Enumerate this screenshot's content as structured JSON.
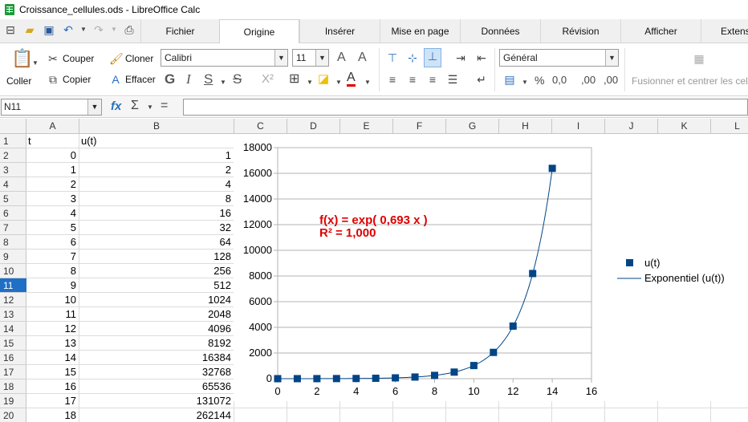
{
  "window": {
    "title": "Croissance_cellules.ods - LibreOffice Calc"
  },
  "tabs": [
    "Fichier",
    "Origine",
    "Insérer",
    "Mise en page",
    "Données",
    "Révision",
    "Afficher",
    "Extensi"
  ],
  "active_tab": "Origine",
  "ribbon": {
    "paste_label": "Coller",
    "cut_label": "Couper",
    "copy_label": "Copier",
    "clone_label": "Cloner",
    "clear_label": "Effacer",
    "font_name": "Calibri",
    "font_size": "11",
    "number_format": "Général",
    "merge_label": "Fusionner et centrer les cellules",
    "percent_symbol": "%",
    "decimal_symbol": "0,0",
    "add_decimal_symbol": ",00",
    "remove_decimal_symbol": ",00"
  },
  "formula_bar": {
    "name_box": "N11",
    "formula": ""
  },
  "columns": [
    "A",
    "B",
    "C",
    "D",
    "E",
    "F",
    "G",
    "H",
    "I",
    "J",
    "K",
    "L"
  ],
  "rows": [
    "1",
    "2",
    "3",
    "4",
    "5",
    "6",
    "7",
    "8",
    "9",
    "10",
    "11",
    "12",
    "13",
    "14",
    "15",
    "16",
    "17",
    "18",
    "19",
    "20"
  ],
  "selected_row": "11",
  "header_row": {
    "a": "t",
    "b": "u(t)"
  },
  "data_rows": [
    {
      "t": "0",
      "u": "1"
    },
    {
      "t": "1",
      "u": "2"
    },
    {
      "t": "2",
      "u": "4"
    },
    {
      "t": "3",
      "u": "8"
    },
    {
      "t": "4",
      "u": "16"
    },
    {
      "t": "5",
      "u": "32"
    },
    {
      "t": "6",
      "u": "64"
    },
    {
      "t": "7",
      "u": "128"
    },
    {
      "t": "8",
      "u": "256"
    },
    {
      "t": "9",
      "u": "512"
    },
    {
      "t": "10",
      "u": "1024"
    },
    {
      "t": "11",
      "u": "2048"
    },
    {
      "t": "12",
      "u": "4096"
    },
    {
      "t": "13",
      "u": "8192"
    },
    {
      "t": "14",
      "u": "16384"
    },
    {
      "t": "15",
      "u": "32768"
    },
    {
      "t": "16",
      "u": "65536"
    },
    {
      "t": "17",
      "u": "131072"
    },
    {
      "t": "18",
      "u": "262144"
    }
  ],
  "chart_data": {
    "type": "scatter",
    "title": "",
    "xlabel": "",
    "ylabel": "",
    "xlim": [
      0,
      16
    ],
    "ylim": [
      0,
      18000
    ],
    "xticks": [
      "0",
      "2",
      "4",
      "6",
      "8",
      "10",
      "12",
      "14",
      "16"
    ],
    "yticks": [
      "0",
      "2000",
      "4000",
      "6000",
      "8000",
      "10000",
      "12000",
      "14000",
      "16000",
      "18000"
    ],
    "grid": "horizontal",
    "legend": "right",
    "series": [
      {
        "name": "u(t)",
        "x": [
          0,
          1,
          2,
          3,
          4,
          5,
          6,
          7,
          8,
          9,
          10,
          11,
          12,
          13,
          14
        ],
        "y": [
          1,
          2,
          4,
          8,
          16,
          32,
          64,
          128,
          256,
          512,
          1024,
          2048,
          4096,
          8192,
          16384
        ],
        "color": "#004586"
      }
    ],
    "trendline": {
      "name": "Exponentiel (u(t))",
      "type": "exponential",
      "coefficient": 0.693,
      "color": "#004586"
    },
    "annotation": {
      "equation": "f(x) = exp( 0,693 x )",
      "r2": "R² = 1,000",
      "color": "#e00000"
    }
  }
}
